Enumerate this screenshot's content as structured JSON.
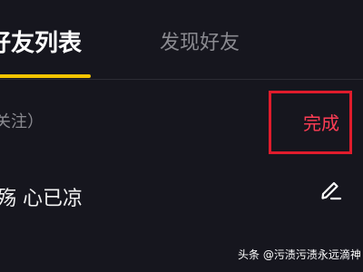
{
  "tabs": {
    "friends_list": "好友列表",
    "discover_friends": "发现好友"
  },
  "colors": {
    "tab_indicator": "#f5c400",
    "done_text": "#ff3d55",
    "highlight_box": "#e01c2c"
  },
  "following": {
    "label": "关注）",
    "done_label": "完成"
  },
  "friend": {
    "name": "殇 心已凉"
  },
  "watermark": {
    "text": "头条 @污渍污渍永远滴神"
  },
  "icons": {
    "edit": "pencil-edit-icon"
  }
}
